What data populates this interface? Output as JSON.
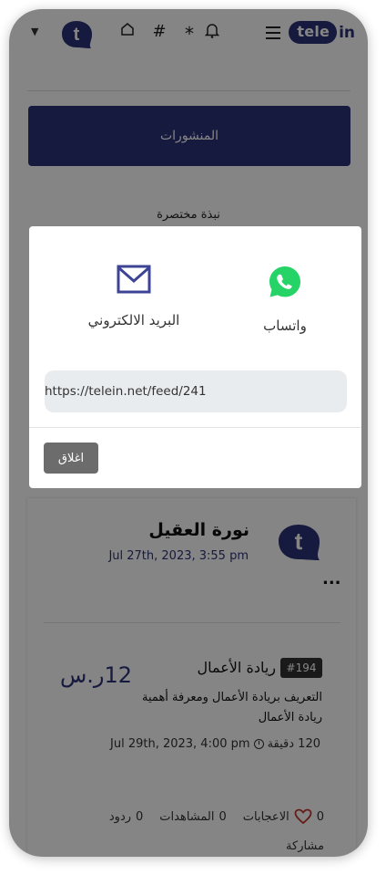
{
  "header": {
    "logo_text": "tele",
    "logo_suffix": "in",
    "hash_icon": "#",
    "star_icon": "*"
  },
  "profile": {
    "posts_button": "المنشورات",
    "bio_title": "نبذة مختصرة"
  },
  "share_modal": {
    "whatsapp_label": "واتساب",
    "email_label": "البريد الالكتروني",
    "url": "https://telein.net/feed/241",
    "close_label": "اغلاق"
  },
  "post": {
    "author_name": "نورة العقيل",
    "date": "Jul 27th, 2023, 3:55 pm",
    "more": "...",
    "course": {
      "tag": "#194",
      "title": "ريادة الأعمال",
      "price": "12ر.س",
      "description": "التعريف بريادة الأعمال ومعرفة أهمية ريادة الأعمال",
      "duration": "120 دقيقة",
      "datetime": "Jul 29th, 2023, 4:00 pm"
    },
    "stats": {
      "likes_count": "0",
      "likes_label": "الاعجابات",
      "views_count": "0",
      "views_label": "المشاهدات",
      "replies_count": "0",
      "replies_label": "ردود"
    },
    "share_label": "مشاركة"
  },
  "colors": {
    "brand": "#2c3279",
    "whatsapp": "#25d366",
    "like": "#c0392b",
    "close_button": "#6c6c6c"
  }
}
